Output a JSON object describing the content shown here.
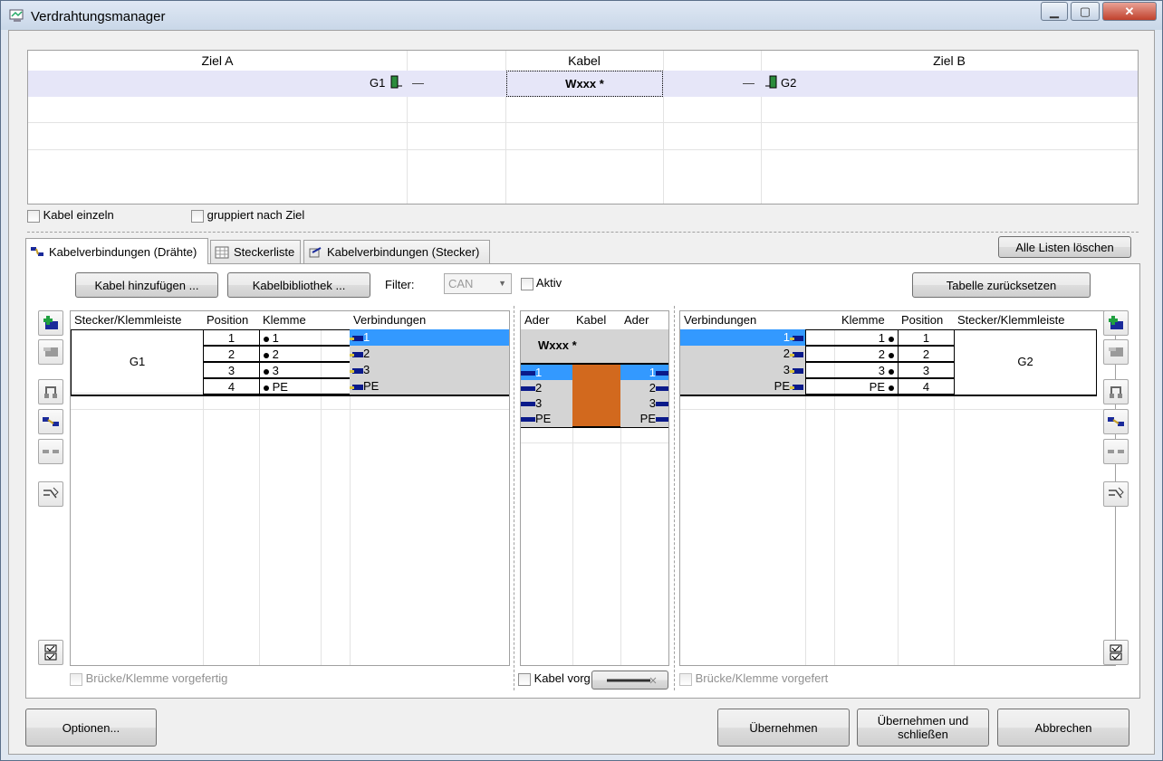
{
  "window": {
    "title": "Verdrahtungsmanager",
    "minimize": "▁",
    "maximize": "▢",
    "close": "✕"
  },
  "top_grid": {
    "headers": {
      "ziel_a": "Ziel A",
      "kabel": "Kabel",
      "ziel_b": "Ziel B"
    },
    "row": {
      "ziel_a": "G1",
      "kabel": "Wxxx *",
      "ziel_b": "G2",
      "dash": "—"
    }
  },
  "options": {
    "kabel_einzeln": "Kabel einzeln",
    "gruppiert": "gruppiert nach Ziel"
  },
  "tabs": [
    "Kabelverbindungen (Drähte)",
    "Steckerliste",
    "Kabelverbindungen (Stecker)"
  ],
  "buttons": {
    "alle_listen": "Alle Listen löschen",
    "kabel_hinzu": "Kabel hinzufügen ...",
    "kabelbib": "Kabelbibliothek ...",
    "tabelle_reset": "Tabelle zurücksetzen",
    "optionen": "Optionen...",
    "uebernehmen": "Übernehmen",
    "uebernehmen_schliessen_1": "Übernehmen und",
    "uebernehmen_schliessen_2": "schließen",
    "abbrechen": "Abbrechen"
  },
  "filter": {
    "label": "Filter:",
    "value": "CAN",
    "aktiv": "Aktiv"
  },
  "left_grid": {
    "headers": [
      "Stecker/Klemmleiste",
      "Position",
      "Klemme",
      "Verbindungen"
    ],
    "stecker": "G1",
    "rows": [
      {
        "position": "1",
        "klemme": "1",
        "verbindung": "1"
      },
      {
        "position": "2",
        "klemme": "2",
        "verbindung": "2"
      },
      {
        "position": "3",
        "klemme": "3",
        "verbindung": "3"
      },
      {
        "position": "4",
        "klemme": "PE",
        "verbindung": "PE"
      }
    ],
    "footer": "Brücke/Klemme vorgefertig"
  },
  "mid_grid": {
    "headers": [
      "Ader",
      "Kabel",
      "Ader"
    ],
    "cable": "Wxxx *",
    "rows": [
      {
        "left": "1",
        "right": "1"
      },
      {
        "left": "2",
        "right": "2"
      },
      {
        "left": "3",
        "right": "3"
      },
      {
        "left": "PE",
        "right": "PE"
      }
    ],
    "footer": "Kabel vorg",
    "cable_color": "#d2691e"
  },
  "right_grid": {
    "headers": [
      "Verbindungen",
      "Klemme",
      "Position",
      "Stecker/Klemmleiste"
    ],
    "stecker": "G2",
    "rows": [
      {
        "verbindung": "1",
        "klemme": "1",
        "position": "1"
      },
      {
        "verbindung": "2",
        "klemme": "2",
        "position": "2"
      },
      {
        "verbindung": "3",
        "klemme": "3",
        "position": "3"
      },
      {
        "verbindung": "PE",
        "klemme": "PE",
        "position": "4"
      }
    ],
    "footer": "Brücke/Klemme vorgefert"
  },
  "colors": {
    "selection": "#3399ff",
    "row_highlight": "#e6e6f8",
    "gray_cell": "#d4d4d4"
  }
}
